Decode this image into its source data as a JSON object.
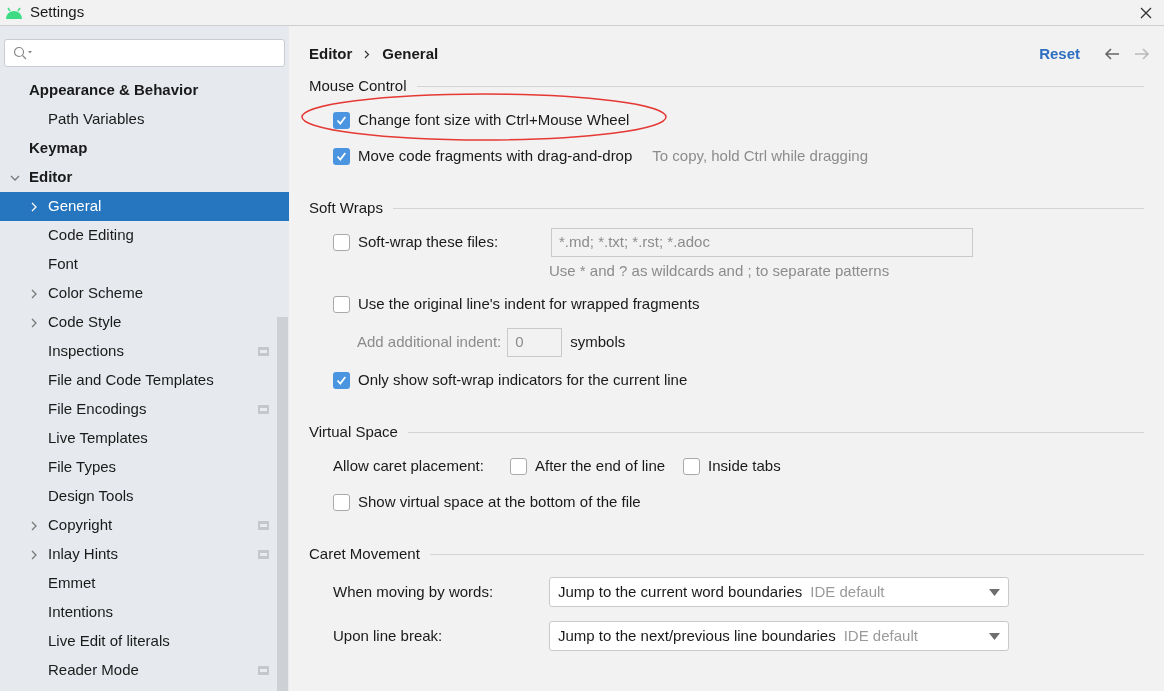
{
  "window": {
    "title": "Settings"
  },
  "sidebar": {
    "items": [
      {
        "label": "Appearance & Behavior",
        "bold": true,
        "expandable": false,
        "selected": false,
        "project_level": false,
        "children": [
          {
            "label": "Path Variables",
            "bold": false,
            "expandable": false,
            "selected": false,
            "project_level": false
          }
        ]
      },
      {
        "label": "Keymap",
        "bold": true,
        "expandable": false,
        "selected": false,
        "project_level": false
      },
      {
        "label": "Editor",
        "bold": true,
        "expandable": true,
        "expanded": true,
        "selected": false,
        "project_level": false,
        "children": [
          {
            "label": "General",
            "bold": false,
            "expandable": true,
            "expanded": false,
            "selected": true,
            "project_level": false
          },
          {
            "label": "Code Editing",
            "bold": false,
            "expandable": false,
            "selected": false,
            "project_level": false
          },
          {
            "label": "Font",
            "bold": false,
            "expandable": false,
            "selected": false,
            "project_level": false
          },
          {
            "label": "Color Scheme",
            "bold": false,
            "expandable": true,
            "expanded": false,
            "selected": false,
            "project_level": false
          },
          {
            "label": "Code Style",
            "bold": false,
            "expandable": true,
            "expanded": false,
            "selected": false,
            "project_level": false
          },
          {
            "label": "Inspections",
            "bold": false,
            "expandable": false,
            "selected": false,
            "project_level": true
          },
          {
            "label": "File and Code Templates",
            "bold": false,
            "expandable": false,
            "selected": false,
            "project_level": false
          },
          {
            "label": "File Encodings",
            "bold": false,
            "expandable": false,
            "selected": false,
            "project_level": true
          },
          {
            "label": "Live Templates",
            "bold": false,
            "expandable": false,
            "selected": false,
            "project_level": false
          },
          {
            "label": "File Types",
            "bold": false,
            "expandable": false,
            "selected": false,
            "project_level": false
          },
          {
            "label": "Design Tools",
            "bold": false,
            "expandable": false,
            "selected": false,
            "project_level": false
          },
          {
            "label": "Copyright",
            "bold": false,
            "expandable": true,
            "expanded": false,
            "selected": false,
            "project_level": true
          },
          {
            "label": "Inlay Hints",
            "bold": false,
            "expandable": true,
            "expanded": false,
            "selected": false,
            "project_level": true
          },
          {
            "label": "Emmet",
            "bold": false,
            "expandable": false,
            "selected": false,
            "project_level": false
          },
          {
            "label": "Intentions",
            "bold": false,
            "expandable": false,
            "selected": false,
            "project_level": false
          },
          {
            "label": "Live Edit of literals",
            "bold": false,
            "expandable": false,
            "selected": false,
            "project_level": false
          },
          {
            "label": "Reader Mode",
            "bold": false,
            "expandable": false,
            "selected": false,
            "project_level": true
          }
        ]
      }
    ]
  },
  "main": {
    "breadcrumb": [
      "Editor",
      "General"
    ],
    "reset": "Reset",
    "sections": [
      {
        "title": "Mouse Control",
        "rows": [
          {
            "kind": "checkbox",
            "label": "Change font size with Ctrl+Mouse Wheel",
            "checked": true,
            "circled": true
          },
          {
            "kind": "checkbox",
            "label": "Move code fragments with drag-and-drop",
            "checked": true,
            "circled": false,
            "hint": "To copy, hold Ctrl while dragging"
          }
        ]
      },
      {
        "title": "Soft Wraps",
        "rows": [
          {
            "kind": "checkbox_field",
            "label": "Soft-wrap these files:",
            "checked": false,
            "value": "*.md; *.txt; *.rst; *.adoc",
            "note": "Use * and ? as wildcards and ; to separate patterns"
          },
          {
            "kind": "checkbox",
            "label": "Use the original line's indent for wrapped fragments",
            "checked": false,
            "circled": false
          },
          {
            "kind": "indent_field",
            "label": "Add additional indent:",
            "value": "0",
            "suffix": "symbols",
            "disabled": true
          },
          {
            "kind": "checkbox",
            "label": "Only show soft-wrap indicators for the current line",
            "checked": true,
            "circled": false
          }
        ]
      },
      {
        "title": "Virtual Space",
        "rows": [
          {
            "kind": "options",
            "label": "Allow caret placement:",
            "options": [
              {
                "label": "After the end of line",
                "checked": false
              },
              {
                "label": "Inside tabs",
                "checked": false
              }
            ]
          },
          {
            "kind": "checkbox",
            "label": "Show virtual space at the bottom of the file",
            "checked": false,
            "circled": false
          }
        ]
      },
      {
        "title": "Caret Movement",
        "rows": [
          {
            "kind": "dropdown",
            "label": "When moving by words:",
            "value": "Jump to the current word boundaries",
            "note": "IDE default"
          },
          {
            "kind": "dropdown",
            "label": "Upon line break:",
            "value": "Jump to the next/previous line boundaries",
            "note": "IDE default"
          }
        ]
      }
    ]
  }
}
